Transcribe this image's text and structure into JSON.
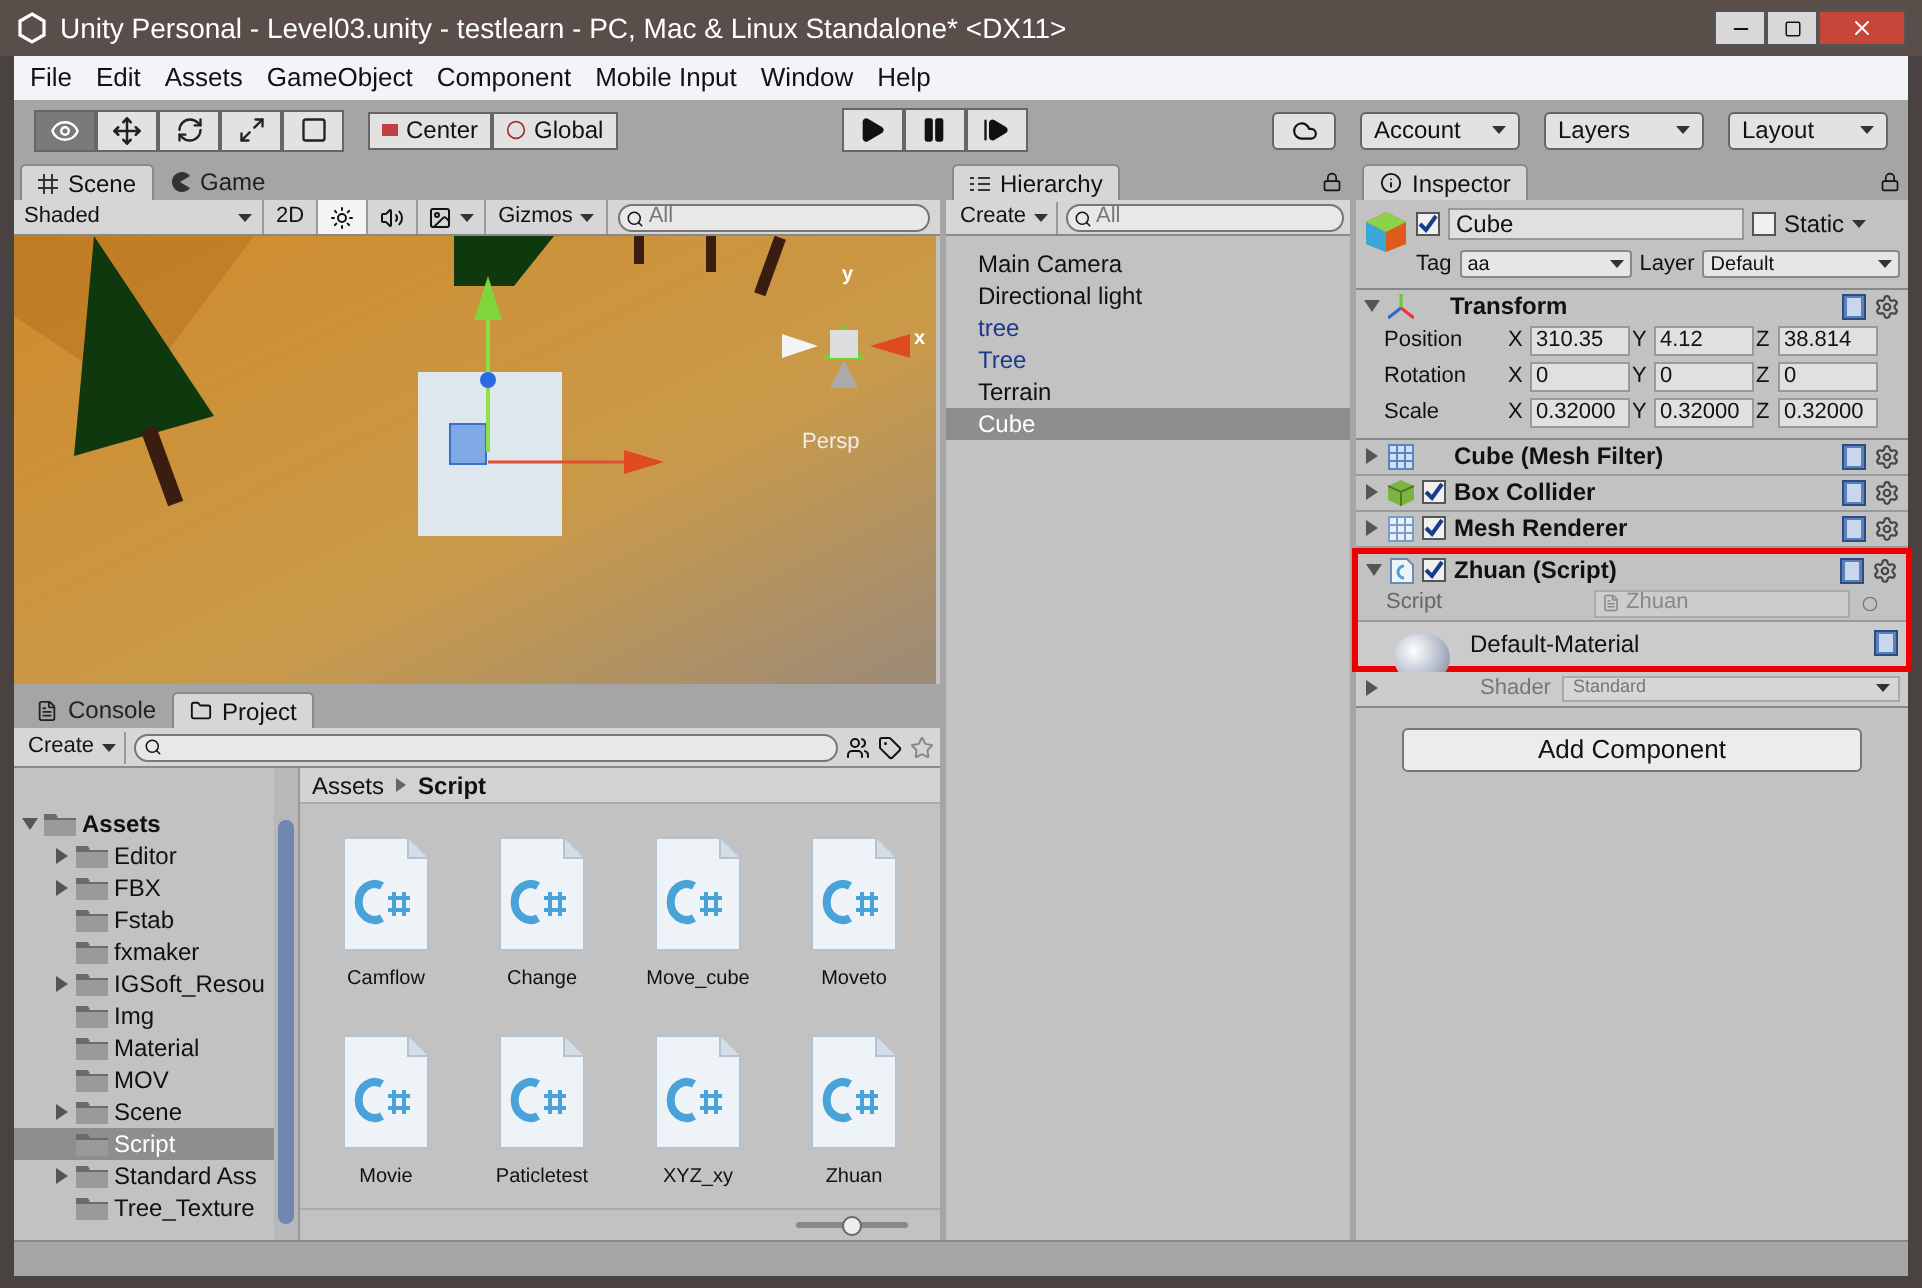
{
  "window": {
    "title": "Unity Personal - Level03.unity - testlearn - PC, Mac & Linux Standalone* <DX11>"
  },
  "menu": [
    "File",
    "Edit",
    "Assets",
    "GameObject",
    "Component",
    "Mobile Input",
    "Window",
    "Help"
  ],
  "toolbar": {
    "tools": [
      {
        "kind": "view",
        "selected": true
      },
      {
        "kind": "move",
        "selected": false
      },
      {
        "kind": "rotate",
        "selected": false
      },
      {
        "kind": "scale",
        "selected": false
      },
      {
        "kind": "rect",
        "selected": false
      }
    ],
    "pivot": "Center",
    "space": "Global",
    "account": "Account",
    "layers": "Layers",
    "layout": "Layout"
  },
  "scene": {
    "tabs": [
      {
        "label": "Scene",
        "kind": "scene",
        "selected": true
      },
      {
        "label": "Game",
        "kind": "game",
        "selected": false
      }
    ],
    "shading": "Shaded",
    "mode_2d": "2D",
    "mode_2d_on": false,
    "lighting_on": true,
    "audio_on": false,
    "gizmos": "Gizmos",
    "search_placeholder": "All",
    "axis_y": "y",
    "axis_x": "x",
    "projection": "Persp"
  },
  "hierarchy": {
    "tab": "Hierarchy",
    "create": "Create",
    "search_placeholder": "All",
    "items": [
      {
        "label": "Main Camera",
        "prefab": false,
        "selected": false
      },
      {
        "label": "Directional light",
        "prefab": false,
        "selected": false
      },
      {
        "label": "tree",
        "prefab": true,
        "selected": false
      },
      {
        "label": "Tree",
        "prefab": true,
        "selected": false
      },
      {
        "label": "Terrain",
        "prefab": false,
        "selected": false
      },
      {
        "label": "Cube",
        "prefab": false,
        "selected": true
      }
    ]
  },
  "inspector": {
    "tab": "Inspector",
    "name": "Cube",
    "active": true,
    "static_label": "Static",
    "static": false,
    "tag_label": "Tag",
    "tag": "aa",
    "layer_label": "Layer",
    "layer": "Default",
    "transform": {
      "title": "Transform",
      "expanded": true,
      "rows": [
        {
          "label": "Position",
          "values": [
            {
              "axis": "X",
              "value": "310.35"
            },
            {
              "axis": "Y",
              "value": "4.12"
            },
            {
              "axis": "Z",
              "value": "38.814"
            }
          ]
        },
        {
          "label": "Rotation",
          "values": [
            {
              "axis": "X",
              "value": "0"
            },
            {
              "axis": "Y",
              "value": "0"
            },
            {
              "axis": "Z",
              "value": "0"
            }
          ]
        },
        {
          "label": "Scale",
          "values": [
            {
              "axis": "X",
              "value": "0.32000"
            },
            {
              "axis": "Y",
              "value": "0.32000"
            },
            {
              "axis": "Z",
              "value": "0.32000"
            }
          ]
        }
      ]
    },
    "components": [
      {
        "name": "Cube (Mesh Filter)",
        "kind": "mesh-filter",
        "expanded": false
      },
      {
        "name": "Box Collider",
        "kind": "collider",
        "expanded": false,
        "enabled": true
      },
      {
        "name": "Mesh Renderer",
        "kind": "renderer",
        "expanded": false,
        "enabled": true
      }
    ],
    "script": {
      "name": "Zhuan (Script)",
      "expanded": true,
      "enabled": true,
      "field_label": "Script",
      "field_value": "Zhuan",
      "highlighted": true
    },
    "material": {
      "name": "Default-Material",
      "expanded": false,
      "shader_label": "Shader",
      "shader": "Standard"
    },
    "add_button": "Add Component"
  },
  "project": {
    "tabs": [
      {
        "label": "Console",
        "kind": "console",
        "selected": false
      },
      {
        "label": "Project",
        "kind": "project",
        "selected": true
      }
    ],
    "create": "Create",
    "tree": [
      {
        "label": "Assets",
        "expanded": true,
        "children": [
          {
            "label": "Editor",
            "expanded": false,
            "selected": false
          },
          {
            "label": "FBX",
            "expanded": false,
            "selected": false
          },
          {
            "label": "Fstab",
            "selected": false
          },
          {
            "label": "fxmaker",
            "selected": false
          },
          {
            "label": "IGSoft_Resou",
            "expanded": false,
            "selected": false
          },
          {
            "label": "Img",
            "selected": false
          },
          {
            "label": "Material",
            "selected": false
          },
          {
            "label": "MOV",
            "selected": false
          },
          {
            "label": "Scene",
            "expanded": false,
            "selected": false
          },
          {
            "label": "Script",
            "selected": true
          },
          {
            "label": "Standard Ass",
            "expanded": false,
            "selected": false
          },
          {
            "label": "Tree_Texture",
            "selected": false
          }
        ]
      }
    ],
    "breadcrumb": [
      "Assets",
      "Script"
    ],
    "files": [
      "Camflow",
      "Change",
      "Move_cube",
      "Moveto",
      "Movie",
      "Paticletest",
      "XYZ_xy",
      "Zhuan"
    ],
    "zoom": {
      "level": 0.5
    }
  }
}
